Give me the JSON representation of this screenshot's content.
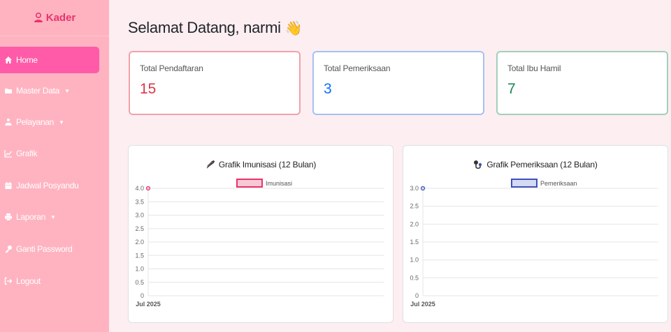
{
  "sidebar": {
    "brand": "Kader",
    "items": [
      {
        "label": "Home",
        "icon": "home-icon",
        "dropdown": false,
        "active": true
      },
      {
        "label": "Master Data",
        "icon": "folder-icon",
        "dropdown": true
      },
      {
        "label": "Pelayanan",
        "icon": "service-icon",
        "dropdown": true
      },
      {
        "label": "Grafik",
        "icon": "chart-line-icon",
        "dropdown": false
      },
      {
        "label": "Jadwal Posyandu",
        "icon": "calendar-icon",
        "dropdown": false
      },
      {
        "label": "Laporan",
        "icon": "print-icon",
        "dropdown": true
      },
      {
        "label": "Ganti Password",
        "icon": "key-icon",
        "dropdown": false
      },
      {
        "label": "Logout",
        "icon": "logout-icon",
        "dropdown": false
      }
    ]
  },
  "header": {
    "greeting": "Selamat Datang, narmi",
    "emoji": "👋"
  },
  "stats": [
    {
      "label": "Total Pendaftaran",
      "value": "15",
      "color": "#dc3545",
      "border": "#f0a2ab"
    },
    {
      "label": "Total Pemeriksaan",
      "value": "3",
      "color": "#0d6efd",
      "border": "#a6c1f2"
    },
    {
      "label": "Total Ibu Hamil",
      "value": "7",
      "color": "#198754",
      "border": "#a3cfbb"
    }
  ],
  "colors": {
    "sidebar": "#ffb3c1",
    "active": "#ff5ba8",
    "brand": "#e8336d",
    "background": "#fdeef2"
  },
  "chart_data": [
    {
      "type": "line",
      "title": "Grafik Imunisasi (12 Bulan)",
      "title_icon": "syringe-icon",
      "x": [
        "Jul 2025"
      ],
      "series": [
        {
          "name": "Imunisasi",
          "values": [
            4
          ],
          "color": "#e8336d",
          "fill": "#f8c9d4"
        }
      ],
      "yticks": [
        "4.0",
        "3.5",
        "3.0",
        "2.5",
        "2.0",
        "1.5",
        "1.0",
        "0.5",
        "0"
      ],
      "ylim": [
        0,
        4
      ],
      "grid": true,
      "legend": "top"
    },
    {
      "type": "line",
      "title": "Grafik Pemeriksaan (12 Bulan)",
      "title_icon": "stethoscope-icon",
      "x": [
        "Jul 2025"
      ],
      "series": [
        {
          "name": "Pemeriksaan",
          "values": [
            3
          ],
          "color": "#3f51b5",
          "fill": "#d4d9f4"
        }
      ],
      "yticks": [
        "3.0",
        "2.5",
        "2.0",
        "1.5",
        "1.0",
        "0.5",
        "0"
      ],
      "ylim": [
        0,
        3
      ],
      "grid": true,
      "legend": "top"
    }
  ]
}
